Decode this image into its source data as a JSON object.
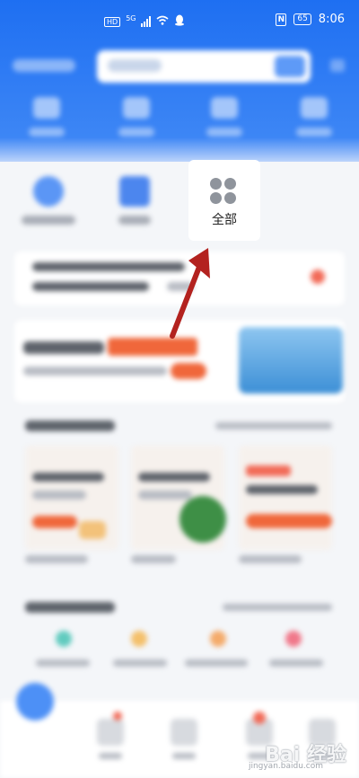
{
  "status_bar": {
    "hd": "HD",
    "network": "5G",
    "battery": "65",
    "nfc": "N",
    "time": "8:06"
  },
  "main": {
    "all_entry": {
      "label": "全部"
    }
  },
  "watermark": {
    "brand": "Bai 经验",
    "domain": "jingyan.baidu.com"
  },
  "colors": {
    "header_blue": "#1e6ff2",
    "annotation_arrow": "#b3221f",
    "accent_orange": "#f0673b"
  }
}
